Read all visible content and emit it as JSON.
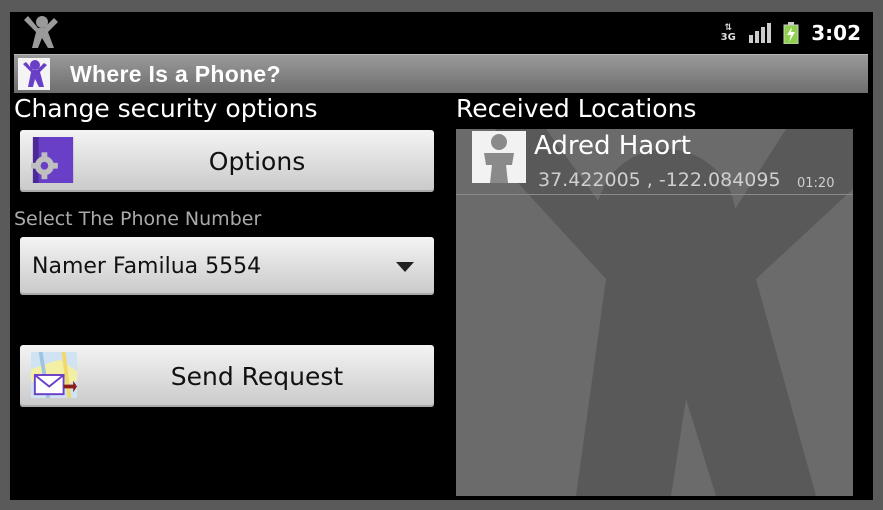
{
  "status_bar": {
    "network": "3G",
    "time": "3:02",
    "icons": [
      "app-notification-icon",
      "network-3g-icon",
      "signal-icon",
      "battery-charging-icon"
    ]
  },
  "title_bar": {
    "title": "Where Is a Phone?",
    "icon": "app-person-icon"
  },
  "left": {
    "security_heading": "Change security options",
    "options_button": {
      "label": "Options",
      "icon": "options-gear-icon"
    },
    "phone_select_label": "Select The Phone Number",
    "phone_select": {
      "selected": "Namer Familua 5554"
    },
    "send_button": {
      "label": "Send Request",
      "icon": "map-envelope-icon"
    }
  },
  "right": {
    "heading": "Received Locations",
    "locations": [
      {
        "name": "Adred Haort",
        "coords": "37.422005 ,  -122.084095",
        "time": "01:20",
        "avatar": "contact-avatar-icon"
      }
    ]
  },
  "colors": {
    "app_purple": "#6a3fc7",
    "screen_bg": "#000000",
    "list_bg": "#6b6b6b"
  }
}
